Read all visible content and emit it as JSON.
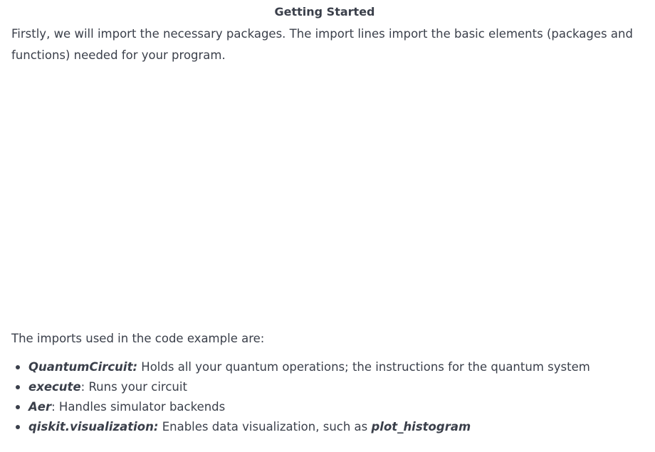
{
  "heading": "Getting Started",
  "intro_paragraph": "Firstly, we will import the necessary packages. The import lines import the basic elements (packages and functions) needed for your program.",
  "imports_intro": "The imports used in the code example are:",
  "imports": [
    {
      "term": "QuantumCircuit:",
      "description": " Holds all your quantum operations; the instructions for the quantum system",
      "extra_term": ""
    },
    {
      "term": "execute",
      "description": ": Runs your circuit",
      "extra_term": ""
    },
    {
      "term": "Aer",
      "description": ": Handles simulator backends",
      "extra_term": ""
    },
    {
      "term": "qiskit.visualization:",
      "description": " Enables data visualization, such as ",
      "extra_term": "plot_histogram"
    }
  ]
}
